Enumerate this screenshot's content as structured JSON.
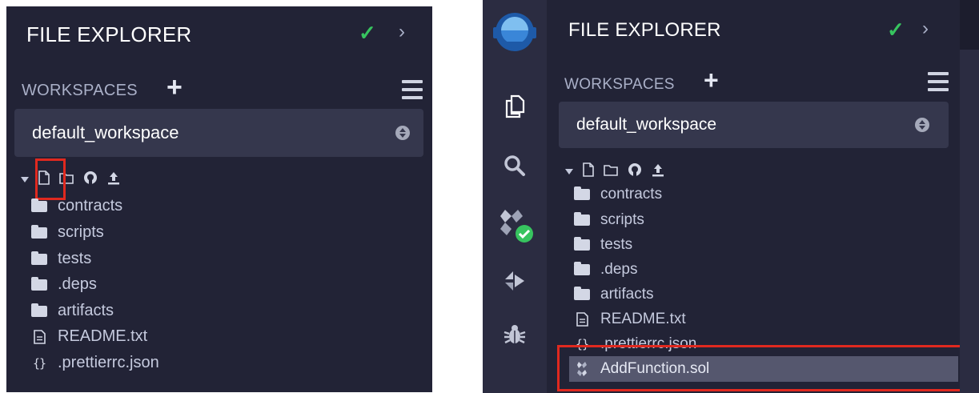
{
  "left": {
    "header": {
      "title": "FILE EXPLORER",
      "check_icon": "check-icon",
      "chevron_icon": "chevron-right-icon"
    },
    "workspaces": {
      "label": "WORKSPACES",
      "add_icon": "plus-icon",
      "menu_icon": "hamburger-icon"
    },
    "workspace_select": {
      "value": "default_workspace"
    },
    "toolbar": [
      "caret-down-icon",
      "new-file-icon",
      "new-folder-icon",
      "github-icon",
      "upload-icon"
    ],
    "tree": [
      {
        "icon": "folder-icon",
        "label": "contracts"
      },
      {
        "icon": "folder-icon",
        "label": "scripts"
      },
      {
        "icon": "folder-icon",
        "label": "tests"
      },
      {
        "icon": "folder-icon",
        "label": ".deps"
      },
      {
        "icon": "folder-icon",
        "label": "artifacts"
      },
      {
        "icon": "file-text-icon",
        "label": "README.txt"
      },
      {
        "icon": "json-braces-icon",
        "label": ".prettierrc.json"
      }
    ],
    "highlight_color": "#e0291f"
  },
  "right": {
    "sidebar_icons": [
      "remix-logo-icon",
      "file-explorer-icon",
      "search-icon",
      "solidity-compiler-icon",
      "deploy-icon",
      "debugger-icon"
    ],
    "header": {
      "title": "FILE EXPLORER",
      "check_icon": "check-icon",
      "chevron_icon": "chevron-right-icon"
    },
    "workspaces": {
      "label": "WORKSPACES",
      "add_icon": "plus-icon",
      "menu_icon": "hamburger-icon"
    },
    "workspace_select": {
      "value": "default_workspace"
    },
    "toolbar": [
      "caret-down-icon",
      "new-file-icon",
      "new-folder-icon",
      "github-icon",
      "upload-icon"
    ],
    "tree": [
      {
        "icon": "folder-icon",
        "label": "contracts"
      },
      {
        "icon": "folder-icon",
        "label": "scripts"
      },
      {
        "icon": "folder-icon",
        "label": "tests"
      },
      {
        "icon": "folder-icon",
        "label": ".deps"
      },
      {
        "icon": "folder-icon",
        "label": "artifacts"
      },
      {
        "icon": "file-text-icon",
        "label": "README.txt"
      },
      {
        "icon": "json-braces-icon",
        "label": ".prettierrc.json"
      }
    ],
    "new_file": {
      "icon": "solidity-file-icon",
      "label": "AddFunction.sol"
    },
    "highlight_color": "#e0291f",
    "accent_color": "#37c45f"
  }
}
